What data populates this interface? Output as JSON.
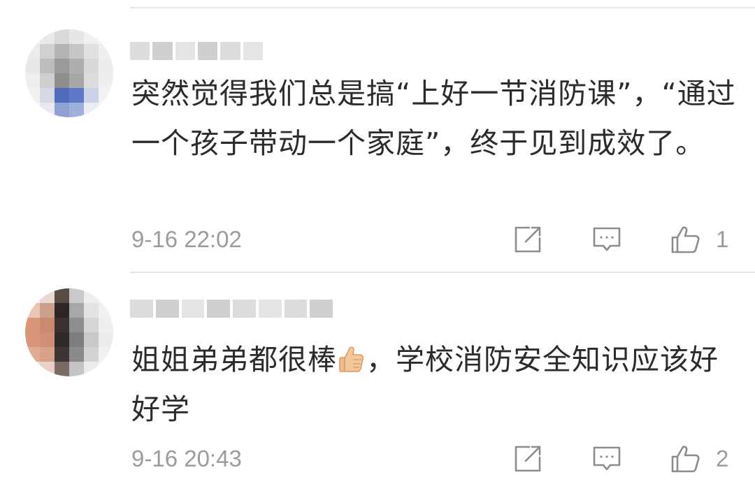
{
  "comments": [
    {
      "username": "nc9587nc",
      "text": "突然觉得我们总是搞“上好一节消防课”，“通过一个孩子带动一个家庭”，终于见到成效了。",
      "timestamp": "9-16 22:02",
      "likes": "1",
      "avatar_icon": "pixelated-avatar"
    },
    {
      "username": "",
      "text_before_emoji": "姐姐弟弟都很棒",
      "emoji": "thumbs-up-emoji",
      "text_after_emoji": "，学校消防安全知识应该好好学",
      "timestamp": "9-16 20:43",
      "likes": "2",
      "avatar_icon": "pixelated-avatar"
    }
  ],
  "icons": {
    "share": "share-icon",
    "reply": "reply-icon",
    "like": "like-icon"
  },
  "colors": {
    "text": "#2b2b2b",
    "meta": "#9b9b9b",
    "divider": "#e6e6e6"
  }
}
